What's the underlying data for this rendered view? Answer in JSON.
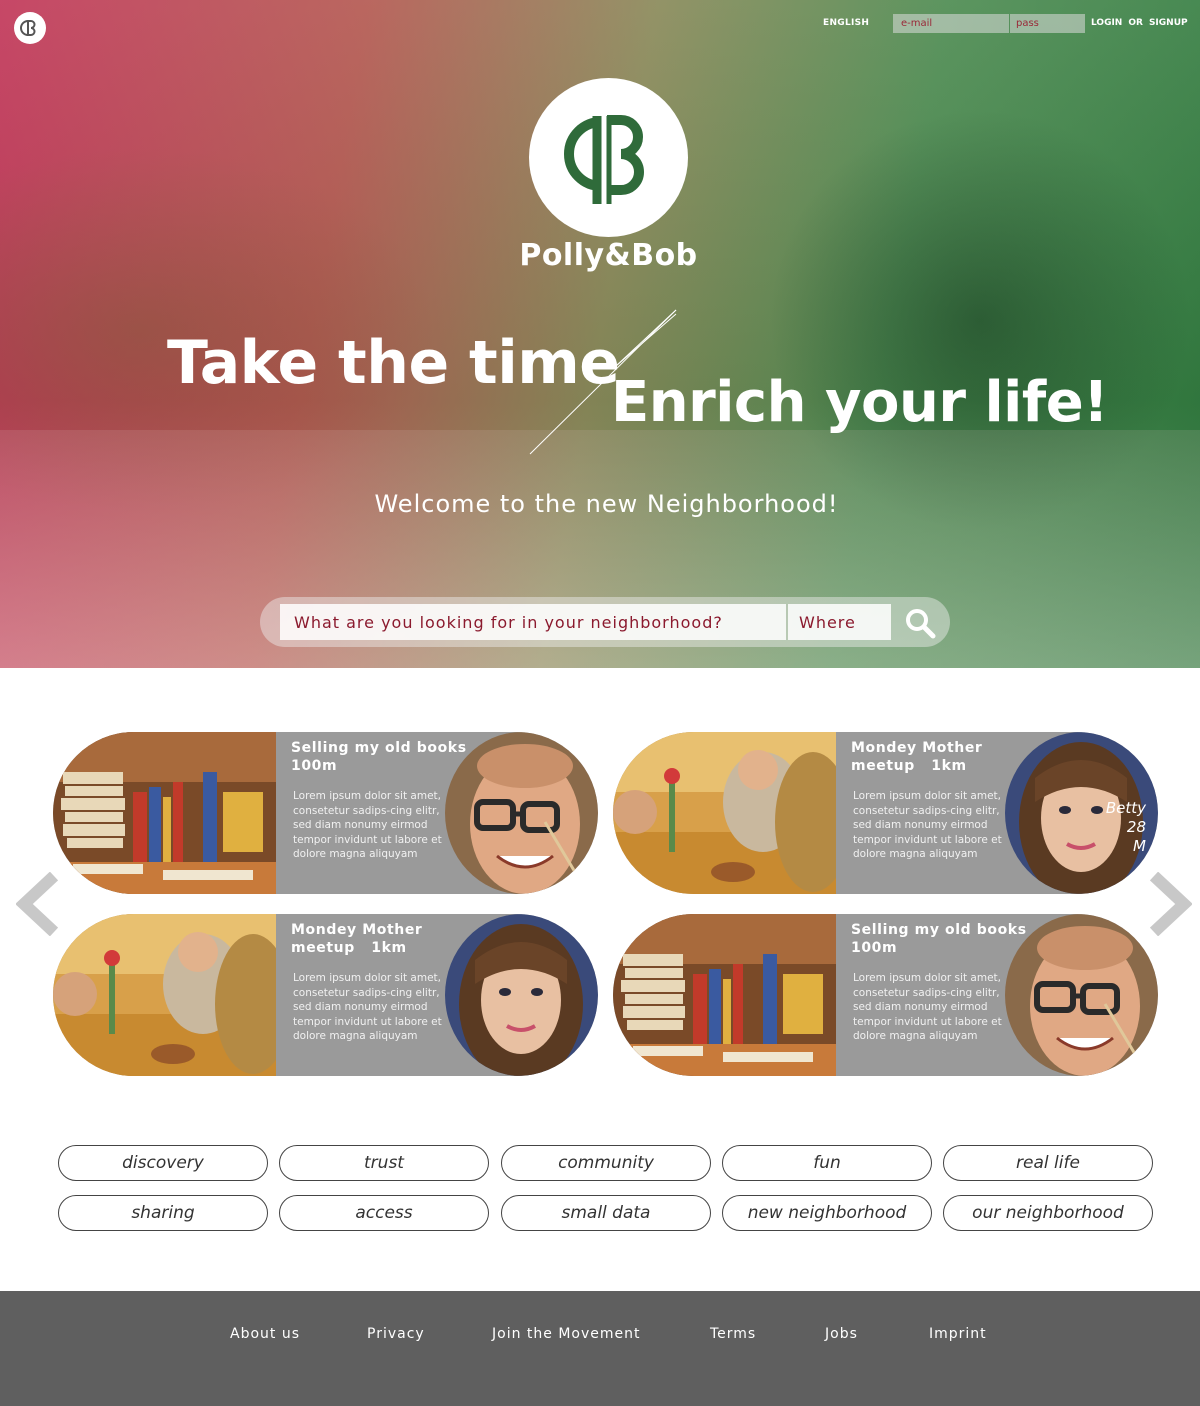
{
  "colors": {
    "hero_left": "#c2385a",
    "hero_right": "#2f7a3e",
    "accent_red": "#8b1a2e",
    "card_bg": "#9a9a9a",
    "footer_bg": "#5f5f5f",
    "white": "#ffffff"
  },
  "header": {
    "language": "ENGLISH",
    "email_placeholder": "e-mail",
    "pass_placeholder": "pass",
    "login": "LOGIN",
    "or": "OR",
    "signup": "SIGNUP",
    "logo_icon": "pb-monogram-icon"
  },
  "hero": {
    "brand": "Polly&Bob",
    "headline_1": "Take the time",
    "headline_2": "Enrich your life!",
    "welcome": "Welcome to the new Neighborhood!",
    "search_placeholder": "What are you looking for in your neighborhood?",
    "where_placeholder": "Where",
    "search_icon": "search-icon"
  },
  "cards": [
    {
      "title": "Selling my old books",
      "distance": "100m",
      "body": "Lorem ipsum dolor sit amet, consetetur sadips-cing elitr, sed diam nonumy eirmod tempor invidunt ut labore et dolore magna aliquyam",
      "photo": "books",
      "avatar": "man-glasses"
    },
    {
      "title": "Mondey Mother meetup",
      "distance": "1km",
      "body": "Lorem ipsum dolor sit amet, consetetur sadips-cing elitr, sed diam nonumy eirmod tempor invidunt ut labore et dolore magna aliquyam",
      "photo": "mothers",
      "avatar": "woman",
      "name": "Betty",
      "age": "28",
      "gender": "M"
    },
    {
      "title": "Mondey Mother meetup",
      "distance": "1km",
      "body": "Lorem ipsum dolor sit amet, consetetur sadips-cing elitr, sed diam nonumy eirmod tempor invidunt ut labore et dolore magna aliquyam",
      "photo": "mothers",
      "avatar": "woman"
    },
    {
      "title": "Selling my old books",
      "distance": "100m",
      "body": "Lorem ipsum dolor sit amet, consetetur sadips-cing elitr, sed diam nonumy eirmod tempor invidunt ut labore et dolore magna aliquyam",
      "photo": "books",
      "avatar": "man-glasses"
    }
  ],
  "carousel": {
    "prev_icon": "chevron-left-icon",
    "next_icon": "chevron-right-icon"
  },
  "tags": [
    "discovery",
    "trust",
    "community",
    "fun",
    "real life",
    "sharing",
    "access",
    "small data",
    "new neighborhood",
    "our neighborhood"
  ],
  "footer": {
    "links": [
      "About us",
      "Privacy",
      "Join the Movement",
      "Terms",
      "Jobs",
      "Imprint"
    ]
  }
}
